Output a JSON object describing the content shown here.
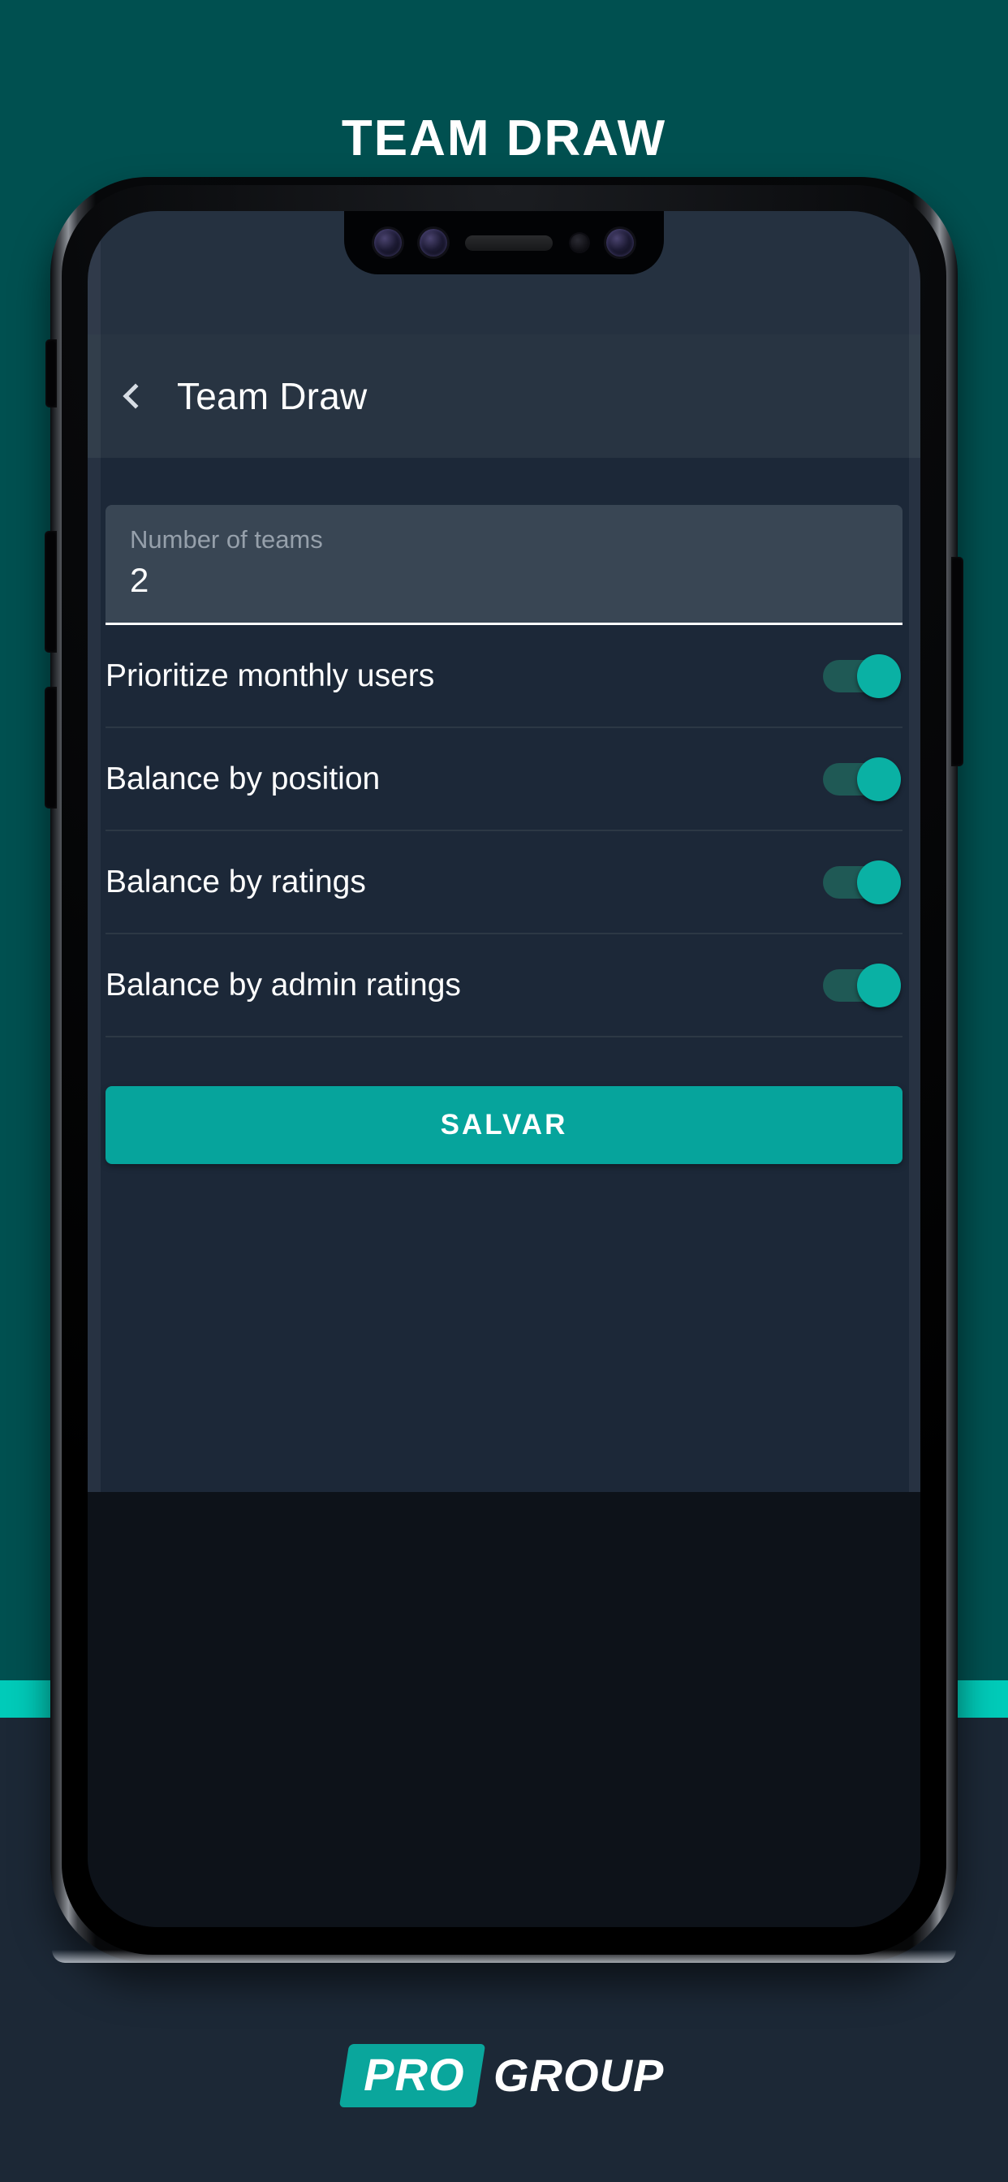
{
  "page": {
    "headline": "TEAM DRAW",
    "background_color": "#005050",
    "stripe_color": "#00CBB9",
    "footer_band_color": "#1C2836",
    "accent_color": "#06A49C"
  },
  "phone": {
    "notch": {
      "sensors": [
        "camera-lens",
        "camera-lens",
        "earpiece-speaker",
        "proximity-sensor",
        "camera-lens"
      ]
    },
    "side_buttons": [
      "silent-switch",
      "volume-up-button",
      "volume-down-button",
      "power-button"
    ]
  },
  "app": {
    "appbar": {
      "back_icon": "chevron-left-icon",
      "title": "Team Draw"
    },
    "number_of_teams_field": {
      "label": "Number of teams",
      "value": "2",
      "placeholder": "Number of teams"
    },
    "settings": [
      {
        "label": "Prioritize monthly users",
        "enabled": "on"
      },
      {
        "label": "Balance by position",
        "enabled": "on"
      },
      {
        "label": "Balance by ratings",
        "enabled": "on"
      },
      {
        "label": "Balance by admin ratings",
        "enabled": "on"
      }
    ],
    "save_button": {
      "label": "SALVAR"
    }
  },
  "footer": {
    "logo_mark": "PRO",
    "logo_word": "GROUP"
  }
}
